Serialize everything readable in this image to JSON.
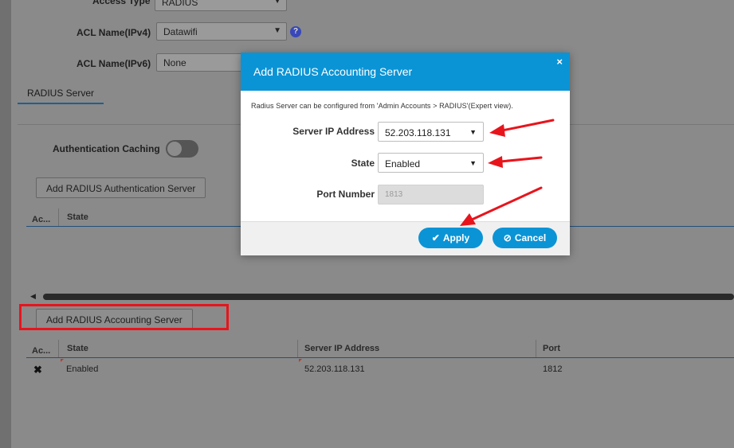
{
  "background": {
    "access_type_label": "Access Type",
    "access_type_value": "RADIUS",
    "acl_ipv4_label": "ACL Name(IPv4)",
    "acl_ipv4_value": "Datawifi",
    "acl_ipv6_label": "ACL Name(IPv6)",
    "acl_ipv6_value": "None",
    "tab_radius_server": "RADIUS Server",
    "auth_caching_label": "Authentication Caching",
    "add_auth_server_button": "Add RADIUS Authentication Server",
    "auth_table": {
      "headers": [
        "Ac...",
        "State"
      ]
    },
    "add_acct_server_button": "Add RADIUS Accounting Server",
    "acct_table": {
      "headers": [
        "Ac...",
        "State",
        "Server IP Address",
        "Port"
      ],
      "rows": [
        {
          "state": "Enabled",
          "server_ip": "52.203.118.131",
          "port": "1812"
        }
      ]
    }
  },
  "modal": {
    "title": "Add RADIUS Accounting Server",
    "close_glyph": "×",
    "note": "Radius Server can be configured from 'Admin Accounts > RADIUS'(Expert view).",
    "server_ip_label": "Server IP Address",
    "server_ip_value": "52.203.118.131",
    "state_label": "State",
    "state_value": "Enabled",
    "port_label": "Port Number",
    "port_placeholder": "1813",
    "apply_label": "Apply",
    "cancel_label": "Cancel"
  },
  "icons": {
    "dropdown": "chevron-down-icon",
    "help": "help-icon",
    "close": "close-icon",
    "apply": "check-icon",
    "cancel": "ban-icon",
    "delete_row": "x-icon"
  },
  "colors": {
    "accent": "#0a94d6",
    "annotation_red": "#e8141c",
    "overlay_gray": "#8a8a8a"
  }
}
